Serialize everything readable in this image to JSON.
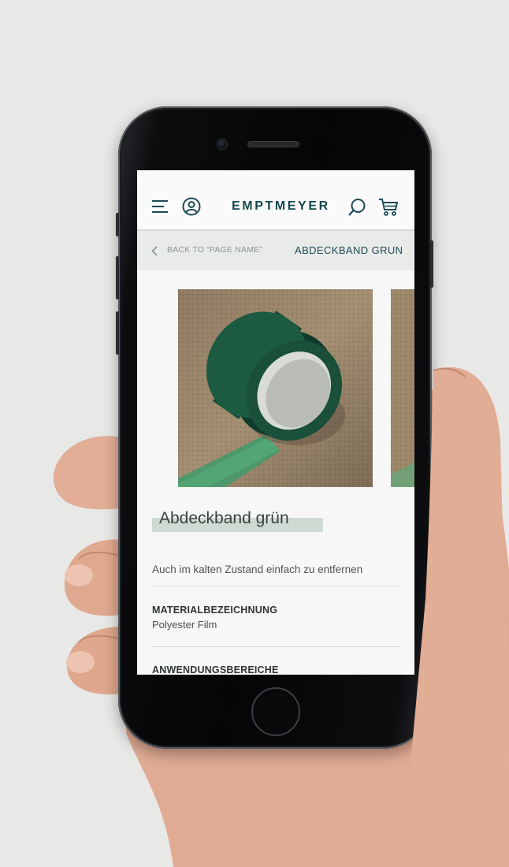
{
  "header": {
    "logo": "EMPTMEYER",
    "icons": [
      "menu-icon",
      "account-icon",
      "search-icon",
      "cart-icon"
    ]
  },
  "breadcrumb": {
    "back_label": "BACK TO “PAGE NAME”",
    "current": "ABDECKBAND GRUN"
  },
  "product": {
    "title": "Abdeckband grün",
    "subtitle": "Auch im kalten Zustand einfach zu entfernen",
    "attributes": [
      {
        "label": "MATERIALBEZEICHNUNG",
        "value": "Polyester Film"
      },
      {
        "label": "ANWENDUNGSBEREICHE",
        "value": ""
      }
    ]
  },
  "colors": {
    "brand": "#14474f",
    "highlight": "#cfdad3",
    "tape_green": "#1f5a45"
  }
}
